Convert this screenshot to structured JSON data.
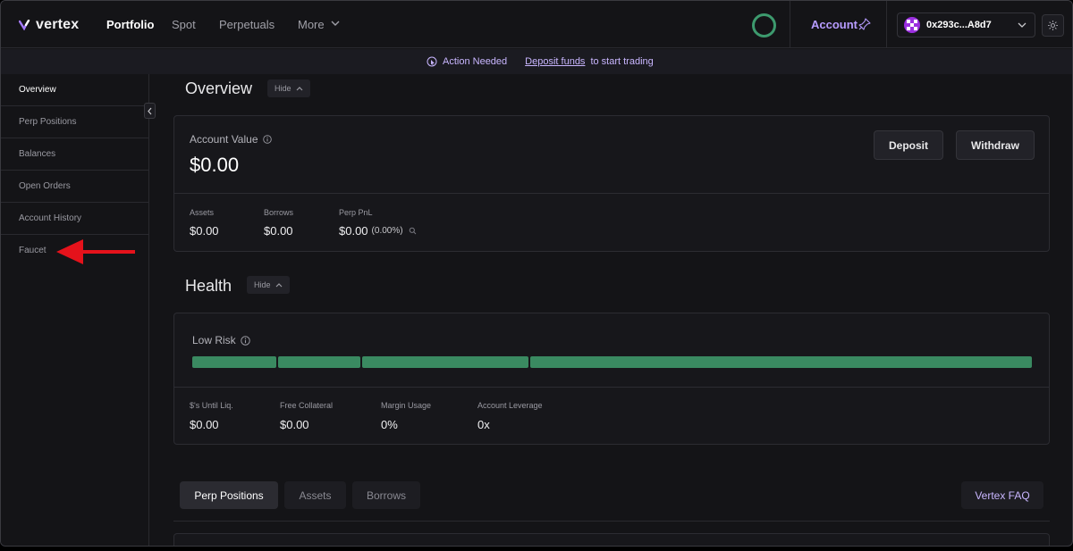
{
  "nav": {
    "brand": "vertex",
    "links": [
      "Portfolio",
      "Spot",
      "Perpetuals",
      "More"
    ],
    "account_label": "Account",
    "wallet_address": "0x293c...A8d7"
  },
  "banner": {
    "action_label": "Action Needed",
    "deposit_link": "Deposit funds",
    "rest_text": "to start trading"
  },
  "sidebar": {
    "items": [
      "Overview",
      "Perp Positions",
      "Balances",
      "Open Orders",
      "Account History",
      "Faucet"
    ],
    "active": "Overview"
  },
  "overview": {
    "title": "Overview",
    "hide_label": "Hide",
    "account_value_label": "Account Value",
    "account_value": "$0.00",
    "deposit_label": "Deposit",
    "withdraw_label": "Withdraw",
    "stats": [
      {
        "label": "Assets",
        "value": "$0.00"
      },
      {
        "label": "Borrows",
        "value": "$0.00"
      },
      {
        "label": "Perp PnL",
        "value": "$0.00",
        "pct": "(0.00%)"
      }
    ]
  },
  "health": {
    "title": "Health",
    "hide_label": "Hide",
    "risk_label": "Low Risk",
    "stats": [
      {
        "label": "$'s Until Liq.",
        "value": "$0.00"
      },
      {
        "label": "Free Collateral",
        "value": "$0.00"
      },
      {
        "label": "Margin Usage",
        "value": "0%"
      },
      {
        "label": "Account Leverage",
        "value": "0x"
      }
    ]
  },
  "tabs": {
    "items": [
      "Perp Positions",
      "Assets",
      "Borrows"
    ],
    "active": "Perp Positions",
    "faq_label": "Vertex FAQ"
  },
  "colors": {
    "accent": "#b79cff",
    "health_bar": "#3a8a61",
    "loader": "#3d9a6e",
    "annotation_arrow": "#e5121b"
  }
}
